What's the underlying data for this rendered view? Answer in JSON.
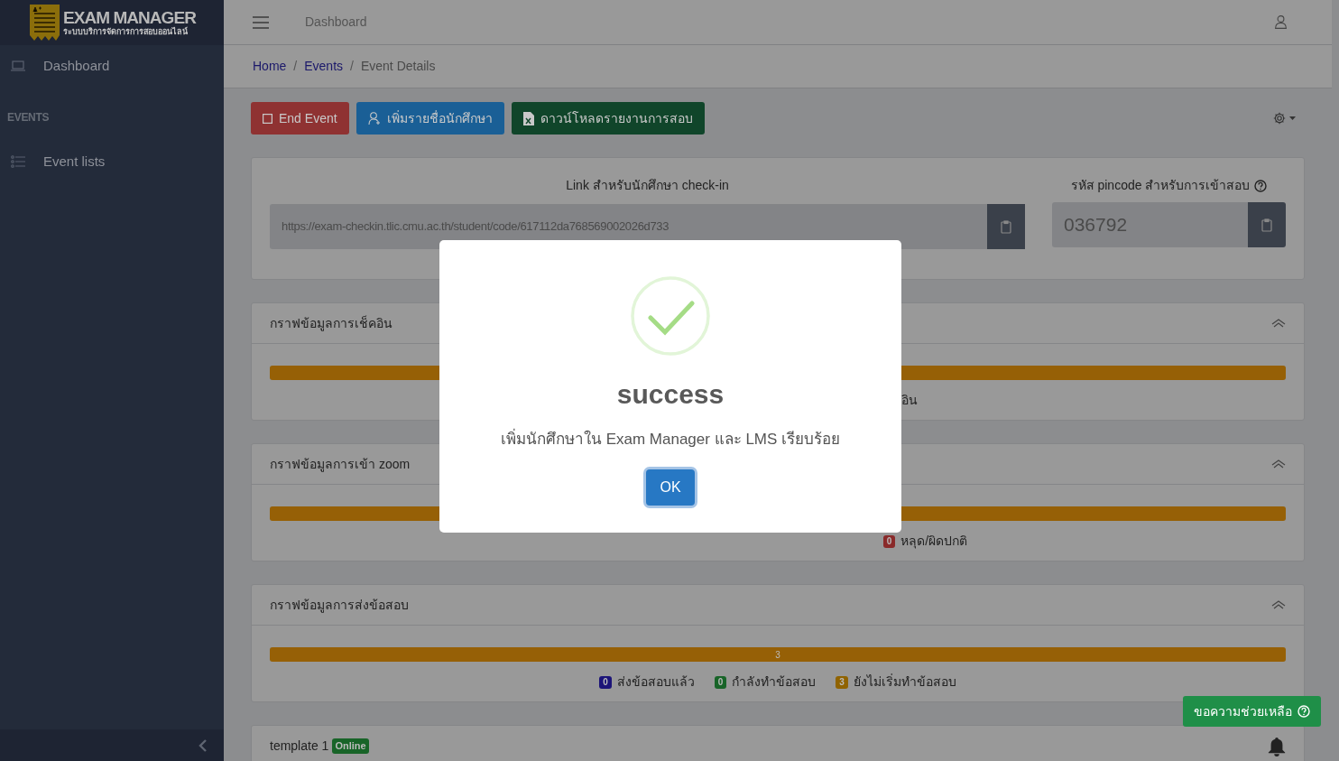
{
  "logo": {
    "title": "EXAM MANAGER",
    "subtitle": "ระบบบริการจัดการการสอบออนไลน์"
  },
  "sidebar": {
    "items": [
      {
        "kind": "link",
        "label": "Dashboard"
      },
      {
        "kind": "heading",
        "label": "EVENTS"
      },
      {
        "kind": "link",
        "label": "Event lists"
      }
    ]
  },
  "header": {
    "title": "Dashboard"
  },
  "breadcrumb": [
    {
      "kind": "link",
      "text": "Home"
    },
    {
      "kind": "separator",
      "text": "/"
    },
    {
      "kind": "link",
      "text": "Events"
    },
    {
      "kind": "separator",
      "text": "/"
    },
    {
      "kind": "current",
      "text": "Event Details"
    }
  ],
  "actions": [
    {
      "kind": "danger",
      "label": "End Event"
    },
    {
      "kind": "primary",
      "label": "เพิ่มรายชื่อนักศึกษา"
    },
    {
      "kind": "success",
      "label": "ดาวน์โหลดรายงานการสอบ"
    }
  ],
  "links": {
    "link_label": "Link สำหรับนักศึกษา check-in",
    "link_value": "https://exam-checkin.tlic.cmu.ac.th/student/code/617112da768569002026d733",
    "pin_label": "รหัส pincode สำหรับการเข้าสอบ",
    "pin_value": "036792"
  },
  "cards": [
    {
      "title": "กราฟข้อมูลการเช็คอิน",
      "level": 1,
      "legend": [
        {
          "label": "อิน"
        }
      ]
    },
    {
      "title": "กราฟข้อมูลการเข้า zoom",
      "level": 1,
      "legend": [
        {
          "count": "0",
          "label": "หลุด/ผิดปกติ",
          "color": "#8a2a2a"
        }
      ]
    },
    {
      "title": "กราฟข้อมูลการส่งข้อสอบ",
      "level": 1,
      "bar_label": "3",
      "legend": [
        {
          "count": "0",
          "label": "ส่งข้อสอบแล้ว",
          "color": "#1c1478"
        },
        {
          "count": "0",
          "label": "กำลังทำข้อสอบ",
          "color": "#186428"
        },
        {
          "count": "3",
          "label": "ยังไม่เริ่มทำข้อสอบ",
          "color": "#906300"
        }
      ]
    }
  ],
  "template": {
    "title": "template 1",
    "badge": "Online"
  },
  "help_button": "ขอความช่วยเหลือ",
  "dialog": {
    "title": "success",
    "message": "เพิ่มนักศึกษาใน Exam Manager และ LMS เรียบร้อย",
    "button": "OK"
  }
}
